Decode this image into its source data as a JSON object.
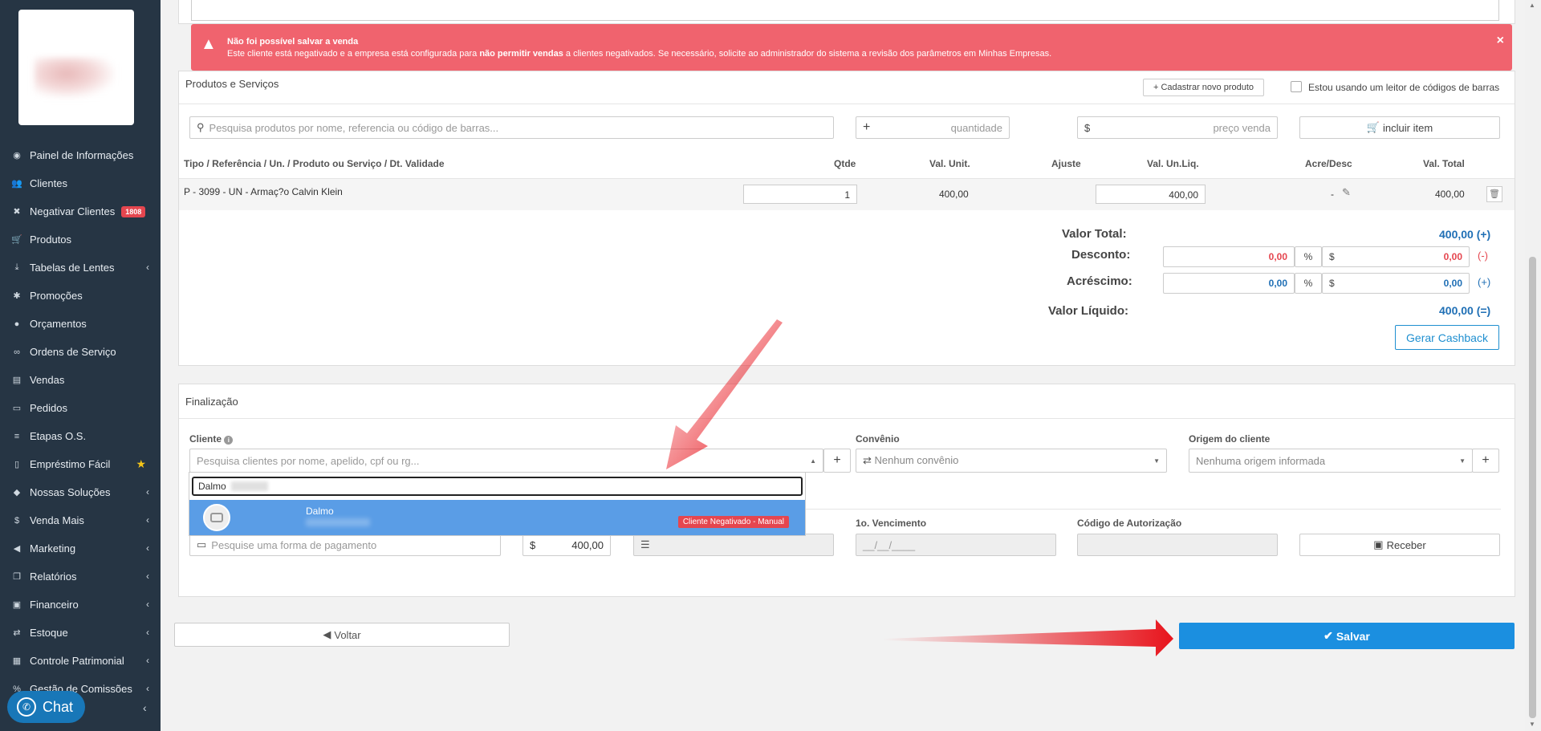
{
  "alert": {
    "title": "Não foi possível salvar a venda",
    "message_pre": "Este cliente está negativado e a empresa está configurada para ",
    "message_bold": "não permitir vendas",
    "message_post": " a clientes negativados. Se necessário, solicite ao administrador do sistema a revisão dos parâmetros em Minhas Empresas.",
    "close": "×"
  },
  "sidebar": {
    "items": [
      {
        "label": "Painel de Informações",
        "icon": "dashboard-icon",
        "arrow": false
      },
      {
        "label": "Clientes",
        "icon": "users-icon",
        "arrow": false
      },
      {
        "label": "Negativar Clientes",
        "icon": "user-x-icon",
        "arrow": false,
        "badge": "1808"
      },
      {
        "label": "Produtos",
        "icon": "cart-icon",
        "arrow": false
      },
      {
        "label": "Tabelas de Lentes",
        "icon": "download-icon",
        "arrow": true
      },
      {
        "label": "Promoções",
        "icon": "asterisk-icon",
        "arrow": false
      },
      {
        "label": "Orçamentos",
        "icon": "user-icon",
        "arrow": false
      },
      {
        "label": "Ordens de Serviço",
        "icon": "glasses-icon",
        "arrow": false
      },
      {
        "label": "Vendas",
        "icon": "basket-icon",
        "arrow": false
      },
      {
        "label": "Pedidos",
        "icon": "inbox-icon",
        "arrow": false
      },
      {
        "label": "Etapas O.S.",
        "icon": "list-icon",
        "arrow": false
      },
      {
        "label": "Empréstimo Fácil",
        "icon": "document-icon",
        "arrow": false,
        "star": true
      },
      {
        "label": "Nossas Soluções",
        "icon": "cubes-icon",
        "arrow": true
      },
      {
        "label": "Venda Mais",
        "icon": "dollar-icon",
        "arrow": true
      },
      {
        "label": "Marketing",
        "icon": "megaphone-icon",
        "arrow": true
      },
      {
        "label": "Relatórios",
        "icon": "copy-icon",
        "arrow": true
      },
      {
        "label": "Financeiro",
        "icon": "money-icon",
        "arrow": true
      },
      {
        "label": "Estoque",
        "icon": "exchange-icon",
        "arrow": true
      },
      {
        "label": "Controle Patrimonial",
        "icon": "building-icon",
        "arrow": true
      },
      {
        "label": "Gestão de Comissões",
        "icon": "percent-icon",
        "arrow": true
      }
    ],
    "chat_label": "Chat"
  },
  "products": {
    "title": "Produtos e Serviços",
    "new_product_btn": "+ Cadastrar novo produto",
    "barcode_label": "Estou usando um leitor de códigos de barras",
    "search_placeholder": "Pesquisa produtos por nome, referencia ou código de barras...",
    "qty_placeholder": "quantidade",
    "price_placeholder": "preço venda",
    "include_btn": "incluir item",
    "headers": [
      "Tipo / Referência / Un. / Produto ou Serviço / Dt. Validade",
      "Qtde",
      "Val. Unit.",
      "Ajuste",
      "Val. Un.Liq.",
      "Acre/Desc",
      "Val. Total"
    ],
    "row": {
      "desc": "P - 3099 - UN - Armaç?o Calvin Klein",
      "qty": "1",
      "unit": "400,00",
      "liq": "400,00",
      "acre": "-",
      "total": "400,00"
    }
  },
  "summary": {
    "valor_total_label": "Valor Total:",
    "valor_total": "400,00 (+)",
    "desconto_label": "Desconto:",
    "desconto_val": "0,00",
    "desconto_pct": "%",
    "desconto_cur": "$",
    "desconto_amt": "0,00",
    "desconto_sign": "(-)",
    "acrescimo_label": "Acréscimo:",
    "acrescimo_val": "0,00",
    "acrescimo_pct": "%",
    "acrescimo_cur": "$",
    "acrescimo_amt": "0,00",
    "acrescimo_sign": "(+)",
    "liquido_label": "Valor Líquido:",
    "liquido": "400,00 (=)",
    "cashback_btn": "Gerar Cashback"
  },
  "finalizacao": {
    "title": "Finalização",
    "cliente_label": "Cliente",
    "cliente_placeholder": "Pesquisa clientes por nome, apelido, cpf ou rg...",
    "convenio_label": "Convênio",
    "convenio_value": "Nenhum convênio",
    "origem_label": "Origem do cliente",
    "origem_value": "Nenhuma origem informada",
    "dropdown_search": "Dalmo",
    "dropdown_option": "Dalmo",
    "dropdown_tag": "Cliente Negativado - Manual",
    "payment_placeholder": "Pesquise uma forma de pagamento",
    "payment_cur": "$",
    "payment_value": "400,00",
    "vencimento_label": "1o. Vencimento",
    "vencimento_value": "__/__/____",
    "autorizacao_label": "Código de Autorização",
    "receber_btn": "Receber"
  },
  "actions": {
    "back_btn": "Voltar",
    "save_btn": "Salvar"
  },
  "colors": {
    "sidebar": "#263544",
    "alert": "#f0636e",
    "primary": "#1b8fe0",
    "arrow": "#e8141c"
  }
}
